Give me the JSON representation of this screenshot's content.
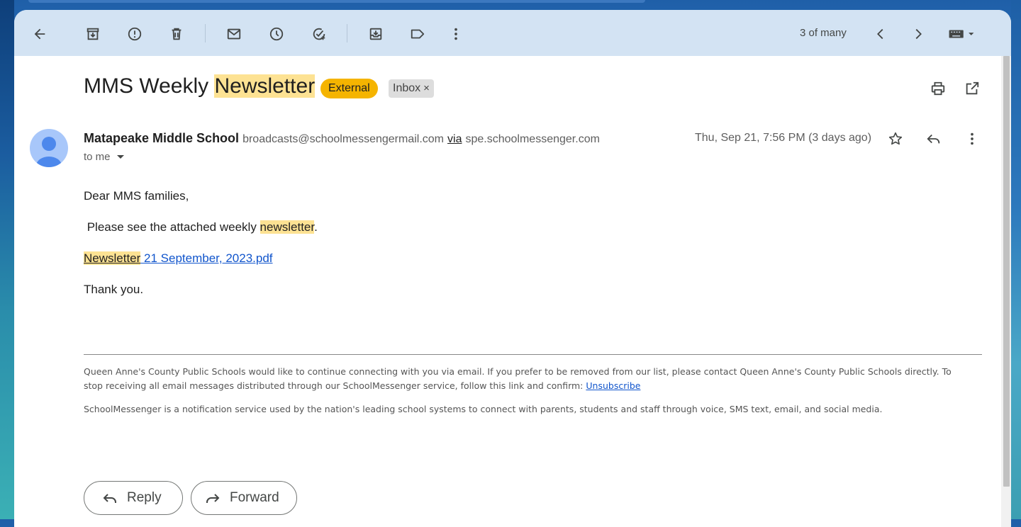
{
  "toolbar": {
    "pager_text": "3 of many"
  },
  "email": {
    "subject_prefix": "MMS Weekly ",
    "subject_highlight": "Newsletter",
    "labels": {
      "external": "External",
      "inbox": "Inbox",
      "inbox_remove": "×"
    },
    "sender": {
      "name": "Matapeake Middle School",
      "email": "broadcasts@schoolmessengermail.com",
      "via_label": "via",
      "via_domain": "spe.schoolmessenger.com"
    },
    "to_me": "to me",
    "date": "Thu, Sep 21, 7:56 PM (3 days ago)",
    "body": {
      "greeting": "Dear MMS families,",
      "line1_prefix": " Please see the attached weekly ",
      "line1_highlight": "newsletter",
      "line1_suffix": ".",
      "attachment_highlight": "Newsletter",
      "attachment_rest": " 21 September, 2023.pdf",
      "closing": "Thank you."
    },
    "footer": {
      "para1": "Queen Anne's County Public Schools would like to continue connecting with you via email. If you prefer to be removed from our list, please contact Queen Anne's County Public Schools directly. To stop receiving all email messages distributed through our SchoolMessenger service, follow this link and confirm: ",
      "unsubscribe": "Unsubscribe",
      "para2": "SchoolMessenger is a notification service used by the nation's leading school systems to connect with parents, students and staff through voice, SMS text, email, and social media."
    }
  },
  "actions": {
    "reply": "Reply",
    "forward": "Forward"
  },
  "colors": {
    "toolbar_bg": "#d3e3f3",
    "external_chip": "#f5b400",
    "highlight": "#fde293",
    "link": "#1155cc"
  }
}
